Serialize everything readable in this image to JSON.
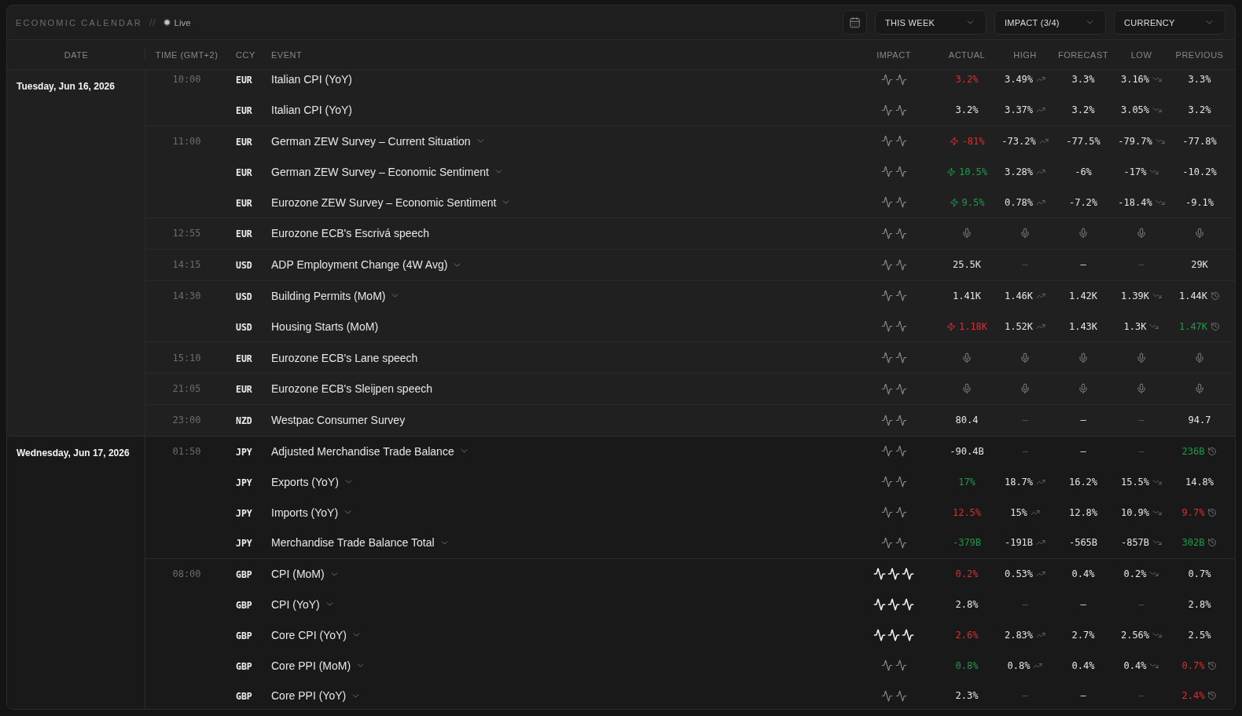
{
  "header": {
    "title": "ECONOMIC CALENDAR",
    "separator": "//",
    "status": "Live",
    "filters": [
      {
        "label": "THIS WEEK"
      },
      {
        "label": "IMPACT (3/4)"
      },
      {
        "label": "CURRENCY"
      }
    ]
  },
  "columns": [
    "DATE",
    "TIME (GMT+2)",
    "CCY",
    "EVENT",
    "IMPACT",
    "ACTUAL",
    "HIGH",
    "FORECAST",
    "LOW",
    "PREVIOUS"
  ],
  "days": [
    {
      "date": "Tuesday, Jun 16, 2026",
      "color": "#202020",
      "groups": [
        {
          "time": "10:00",
          "events": [
            {
              "kind": "release",
              "ccy": "EUR",
              "event": "Italian CPI (YoY)",
              "expandable": false,
              "high_impact": false,
              "actual": {
                "value": "3.2%",
                "positive": false,
                "negative": true,
                "surprise": false
              },
              "high": {
                "value": "3.49%",
                "missing": false
              },
              "forecast": {
                "value": "3.3%"
              },
              "low": {
                "value": "3.16%",
                "missing": false
              },
              "previous": {
                "value": "3.3%",
                "positive": false,
                "negative": false,
                "revised": false
              }
            },
            {
              "kind": "release",
              "ccy": "EUR",
              "event": "Italian CPI (YoY)",
              "expandable": false,
              "high_impact": false,
              "actual": {
                "value": "3.2%",
                "positive": false,
                "negative": false,
                "surprise": false
              },
              "high": {
                "value": "3.37%",
                "missing": false
              },
              "forecast": {
                "value": "3.2%"
              },
              "low": {
                "value": "3.05%",
                "missing": false
              },
              "previous": {
                "value": "3.2%",
                "positive": false,
                "negative": false,
                "revised": false
              }
            }
          ]
        },
        {
          "time": "11:00",
          "events": [
            {
              "kind": "release",
              "ccy": "EUR",
              "event": "German ZEW Survey – Current Situation",
              "expandable": true,
              "high_impact": false,
              "actual": {
                "value": "-81%",
                "positive": false,
                "negative": true,
                "surprise": true
              },
              "high": {
                "value": "-73.2%",
                "missing": false
              },
              "forecast": {
                "value": "-77.5%"
              },
              "low": {
                "value": "-79.7%",
                "missing": false
              },
              "previous": {
                "value": "-77.8%",
                "positive": false,
                "negative": false,
                "revised": false
              }
            },
            {
              "kind": "release",
              "ccy": "EUR",
              "event": "German ZEW Survey – Economic Sentiment",
              "expandable": true,
              "high_impact": false,
              "actual": {
                "value": "10.5%",
                "positive": true,
                "negative": false,
                "surprise": true
              },
              "high": {
                "value": "3.28%",
                "missing": false
              },
              "forecast": {
                "value": "-6%"
              },
              "low": {
                "value": "-17%",
                "missing": false
              },
              "previous": {
                "value": "-10.2%",
                "positive": false,
                "negative": false,
                "revised": false
              }
            },
            {
              "kind": "release",
              "ccy": "EUR",
              "event": "Eurozone ZEW Survey – Economic Sentiment",
              "expandable": true,
              "high_impact": false,
              "actual": {
                "value": "9.5%",
                "positive": true,
                "negative": false,
                "surprise": true
              },
              "high": {
                "value": "0.78%",
                "missing": false
              },
              "forecast": {
                "value": "-7.2%"
              },
              "low": {
                "value": "-18.4%",
                "missing": false
              },
              "previous": {
                "value": "-9.1%",
                "positive": false,
                "negative": false,
                "revised": false
              }
            }
          ]
        },
        {
          "time": "12:55",
          "events": [
            {
              "kind": "speech",
              "ccy": "EUR",
              "event": "Eurozone ECB's Escrivá speech",
              "expandable": false,
              "high_impact": false
            }
          ]
        },
        {
          "time": "14:15",
          "events": [
            {
              "kind": "release",
              "ccy": "USD",
              "event": "ADP Employment Change (4W Avg)",
              "expandable": true,
              "high_impact": false,
              "actual": {
                "value": "25.5K",
                "positive": false,
                "negative": false,
                "surprise": false
              },
              "high": {
                "value": "–",
                "missing": true
              },
              "forecast": {
                "value": "–"
              },
              "low": {
                "value": "–",
                "missing": true
              },
              "previous": {
                "value": "29K",
                "positive": false,
                "negative": false,
                "revised": false
              }
            }
          ]
        },
        {
          "time": "14:30",
          "events": [
            {
              "kind": "release",
              "ccy": "USD",
              "event": "Building Permits (MoM)",
              "expandable": true,
              "high_impact": false,
              "actual": {
                "value": "1.41K",
                "positive": false,
                "negative": false,
                "surprise": false
              },
              "high": {
                "value": "1.46K",
                "missing": false
              },
              "forecast": {
                "value": "1.42K"
              },
              "low": {
                "value": "1.39K",
                "missing": false
              },
              "previous": {
                "value": "1.44K",
                "positive": false,
                "negative": false,
                "revised": true
              }
            },
            {
              "kind": "release",
              "ccy": "USD",
              "event": "Housing Starts (MoM)",
              "expandable": false,
              "high_impact": false,
              "actual": {
                "value": "1.18K",
                "positive": false,
                "negative": true,
                "surprise": true
              },
              "high": {
                "value": "1.52K",
                "missing": false
              },
              "forecast": {
                "value": "1.43K"
              },
              "low": {
                "value": "1.3K",
                "missing": false
              },
              "previous": {
                "value": "1.47K",
                "positive": true,
                "negative": false,
                "revised": true
              }
            }
          ]
        },
        {
          "time": "15:10",
          "events": [
            {
              "kind": "speech",
              "ccy": "EUR",
              "event": "Eurozone ECB's Lane speech",
              "expandable": false,
              "high_impact": false
            }
          ]
        },
        {
          "time": "21:05",
          "events": [
            {
              "kind": "speech",
              "ccy": "EUR",
              "event": "Eurozone ECB's Sleijpen speech",
              "expandable": false,
              "high_impact": false
            }
          ]
        },
        {
          "time": "23:00",
          "events": [
            {
              "kind": "release",
              "ccy": "NZD",
              "event": "Westpac Consumer Survey",
              "expandable": false,
              "high_impact": false,
              "actual": {
                "value": "80.4",
                "positive": false,
                "negative": false,
                "surprise": false
              },
              "high": {
                "value": "–",
                "missing": true
              },
              "forecast": {
                "value": "–"
              },
              "low": {
                "value": "–",
                "missing": true
              },
              "previous": {
                "value": "94.7",
                "positive": false,
                "negative": false,
                "revised": false
              }
            }
          ]
        }
      ]
    },
    {
      "date": "Wednesday, Jun 17, 2026",
      "color": "#191919",
      "groups": [
        {
          "time": "01:50",
          "events": [
            {
              "kind": "release",
              "ccy": "JPY",
              "event": "Adjusted Merchandise Trade Balance",
              "expandable": true,
              "high_impact": false,
              "actual": {
                "value": "-90.4B",
                "positive": false,
                "negative": false,
                "surprise": false
              },
              "high": {
                "value": "–",
                "missing": true
              },
              "forecast": {
                "value": "–"
              },
              "low": {
                "value": "–",
                "missing": true
              },
              "previous": {
                "value": "236B",
                "positive": true,
                "negative": false,
                "revised": true
              }
            },
            {
              "kind": "release",
              "ccy": "JPY",
              "event": "Exports (YoY)",
              "expandable": true,
              "high_impact": false,
              "actual": {
                "value": "17%",
                "positive": true,
                "negative": false,
                "surprise": false
              },
              "high": {
                "value": "18.7%",
                "missing": false
              },
              "forecast": {
                "value": "16.2%"
              },
              "low": {
                "value": "15.5%",
                "missing": false
              },
              "previous": {
                "value": "14.8%",
                "positive": false,
                "negative": false,
                "revised": false
              }
            },
            {
              "kind": "release",
              "ccy": "JPY",
              "event": "Imports (YoY)",
              "expandable": true,
              "high_impact": false,
              "actual": {
                "value": "12.5%",
                "positive": false,
                "negative": true,
                "surprise": false
              },
              "high": {
                "value": "15%",
                "missing": false
              },
              "forecast": {
                "value": "12.8%"
              },
              "low": {
                "value": "10.9%",
                "missing": false
              },
              "previous": {
                "value": "9.7%",
                "positive": false,
                "negative": true,
                "revised": true
              }
            },
            {
              "kind": "release",
              "ccy": "JPY",
              "event": "Merchandise Trade Balance Total",
              "expandable": true,
              "high_impact": false,
              "actual": {
                "value": "-379B",
                "positive": true,
                "negative": false,
                "surprise": false
              },
              "high": {
                "value": "-191B",
                "missing": false
              },
              "forecast": {
                "value": "-565B"
              },
              "low": {
                "value": "-857B",
                "missing": false
              },
              "previous": {
                "value": "302B",
                "positive": true,
                "negative": false,
                "revised": true
              }
            }
          ]
        },
        {
          "time": "08:00",
          "events": [
            {
              "kind": "release",
              "ccy": "GBP",
              "event": "CPI (MoM)",
              "expandable": true,
              "high_impact": true,
              "actual": {
                "value": "0.2%",
                "positive": false,
                "negative": true,
                "surprise": false
              },
              "high": {
                "value": "0.53%",
                "missing": false
              },
              "forecast": {
                "value": "0.4%"
              },
              "low": {
                "value": "0.2%",
                "missing": false
              },
              "previous": {
                "value": "0.7%",
                "positive": false,
                "negative": false,
                "revised": false
              }
            },
            {
              "kind": "release",
              "ccy": "GBP",
              "event": "CPI (YoY)",
              "expandable": true,
              "high_impact": true,
              "actual": {
                "value": "2.8%",
                "positive": false,
                "negative": false,
                "surprise": false
              },
              "high": {
                "value": "–",
                "missing": true
              },
              "forecast": {
                "value": "–"
              },
              "low": {
                "value": "–",
                "missing": true
              },
              "previous": {
                "value": "2.8%",
                "positive": false,
                "negative": false,
                "revised": false
              }
            },
            {
              "kind": "release",
              "ccy": "GBP",
              "event": "Core CPI (YoY)",
              "expandable": true,
              "high_impact": true,
              "actual": {
                "value": "2.6%",
                "positive": false,
                "negative": true,
                "surprise": false
              },
              "high": {
                "value": "2.83%",
                "missing": false
              },
              "forecast": {
                "value": "2.7%"
              },
              "low": {
                "value": "2.56%",
                "missing": false
              },
              "previous": {
                "value": "2.5%",
                "positive": false,
                "negative": false,
                "revised": false
              }
            },
            {
              "kind": "release",
              "ccy": "GBP",
              "event": "Core PPI (MoM)",
              "expandable": true,
              "high_impact": false,
              "actual": {
                "value": "0.8%",
                "positive": true,
                "negative": false,
                "surprise": false
              },
              "high": {
                "value": "0.8%",
                "missing": false
              },
              "forecast": {
                "value": "0.4%"
              },
              "low": {
                "value": "0.4%",
                "missing": false
              },
              "previous": {
                "value": "0.7%",
                "positive": false,
                "negative": true,
                "revised": true
              }
            },
            {
              "kind": "release",
              "ccy": "GBP",
              "event": "Core PPI (YoY)",
              "expandable": true,
              "high_impact": false,
              "actual": {
                "value": "2.3%",
                "positive": false,
                "negative": false,
                "surprise": false
              },
              "high": {
                "value": "–",
                "missing": true
              },
              "forecast": {
                "value": "–"
              },
              "low": {
                "value": "–",
                "missing": true
              },
              "previous": {
                "value": "2.4%",
                "positive": false,
                "negative": true,
                "revised": true
              }
            }
          ]
        }
      ]
    }
  ]
}
